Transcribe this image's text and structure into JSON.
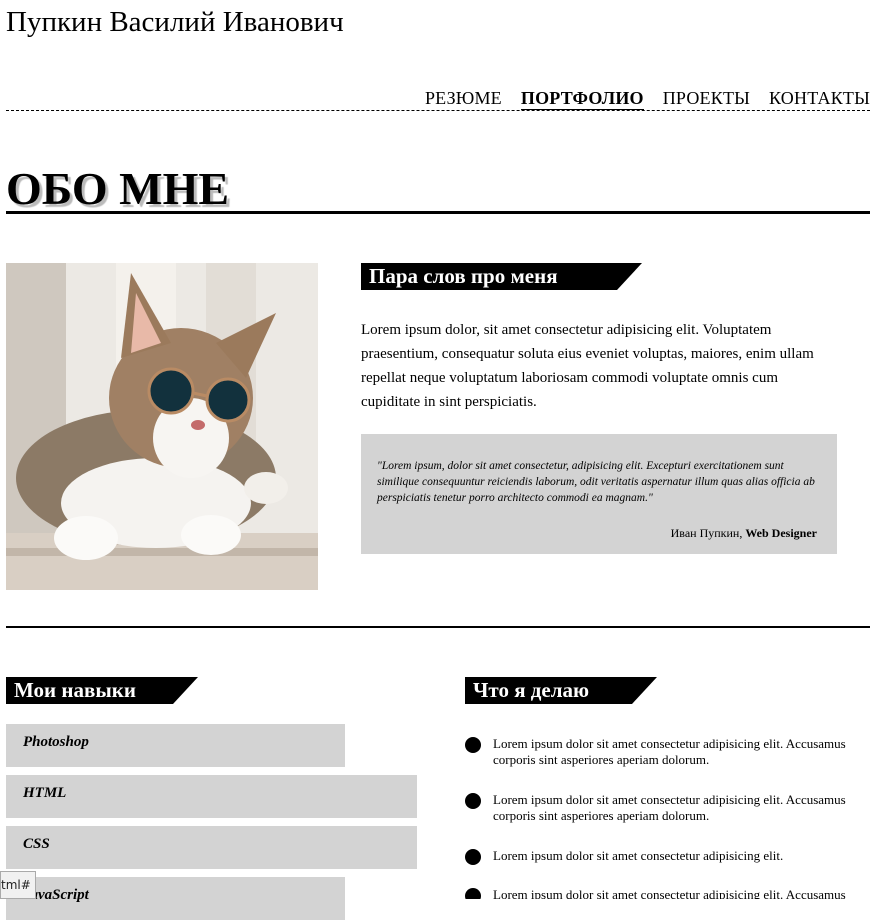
{
  "header": {
    "site_title": "Пупкин Василий Иванович"
  },
  "nav": {
    "items": [
      {
        "label": "РЕЗЮМЕ",
        "active": false
      },
      {
        "label": "ПОРТФОЛИО",
        "active": true
      },
      {
        "label": "ПРОЕКТЫ",
        "active": false
      },
      {
        "label": "КОНТАКТЫ",
        "active": false
      }
    ]
  },
  "about": {
    "title": "ОБО МНЕ",
    "photo_icon": "cat-with-sunglasses-photo",
    "subtitle": "Пара слов про меня",
    "text": "Lorem ipsum dolor, sit amet consectetur adipisicing elit. Voluptatem praesentium, consequatur soluta eius eveniet voluptas, maiores, enim ullam repellat neque voluptatum laboriosam commodi voluptate omnis cum cupiditate in sint perspiciatis.",
    "quote": {
      "text": "\"Lorem ipsum, dolor sit amet consectetur, adipisicing elit. Excepturi exercitationem sunt similique consequuntur reiciendis laborum, odit veritatis aspernatur illum quas alias officia ab perspiciatis tenetur porro architecto commodi ea magnam.\"",
      "author_name": "Иван Пупкин,",
      "author_role": "Web Designer"
    }
  },
  "skills": {
    "title": "Мои навыки",
    "items": [
      {
        "label": "Photoshop",
        "level": 0.81
      },
      {
        "label": "HTML",
        "level": 1.0
      },
      {
        "label": "CSS",
        "level": 1.0
      },
      {
        "label": "JavaScript",
        "level": 0.81
      }
    ]
  },
  "doing": {
    "title": "Что я делаю",
    "items": [
      "Lorem ipsum dolor sit amet consectetur adipisicing elit. Accusamus corporis sint asperiores aperiam dolorum.",
      "Lorem ipsum dolor sit amet consectetur adipisicing elit. Accusamus corporis sint asperiores aperiam dolorum.",
      "Lorem ipsum dolor sit amet consectetur adipisicing elit.",
      "Lorem ipsum dolor sit amet consectetur adipisicing elit. Accusamus corporis sint asperiores aperiam dolorum."
    ]
  },
  "status_bar": {
    "text": "tml#"
  },
  "colors": {
    "accent": "#000000",
    "panel": "#d3d3d3",
    "background": "#ffffff"
  }
}
